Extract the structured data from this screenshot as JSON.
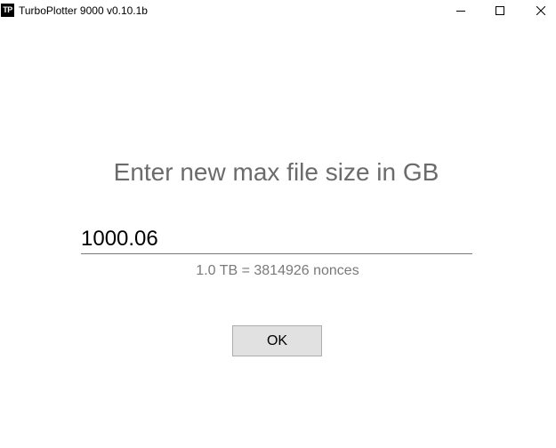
{
  "window": {
    "icon_text": "TP",
    "title": "TurboPlotter 9000 v0.10.1b",
    "controls": {
      "minimize": "minimize-icon",
      "maximize": "maximize-icon",
      "close": "close-icon"
    }
  },
  "dialog": {
    "prompt": "Enter new max file size in GB",
    "size_value": "1000.06",
    "nonce_info": "1.0 TB = 3814926 nonces",
    "ok_label": "OK"
  },
  "colors": {
    "prompt_text": "#6b6b6b",
    "info_text": "#7a7a7a",
    "button_bg": "#e1e1e1",
    "button_border": "#adadad"
  }
}
